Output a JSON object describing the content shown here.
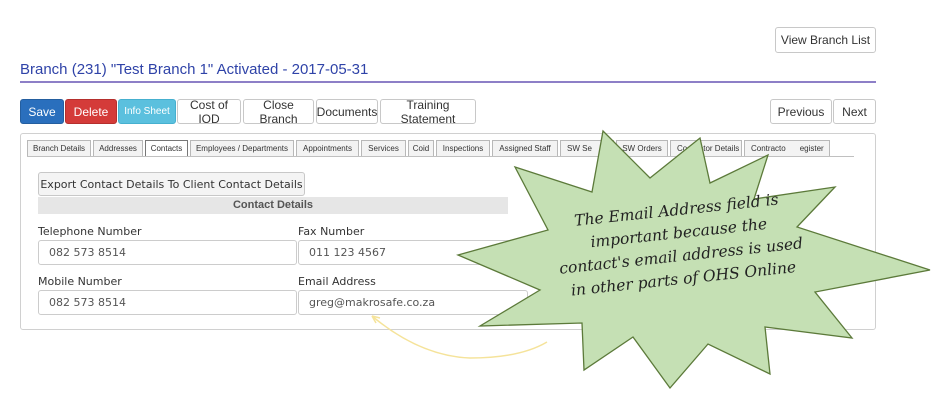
{
  "top_button": "View Branch List",
  "page_title": "Branch (231) \"Test Branch 1\" Activated - 2017-05-31",
  "toolbar": {
    "save": "Save",
    "delete": "Delete",
    "info_sheet": "Info Sheet",
    "cost_of_iod": "Cost of IOD",
    "close_branch": "Close Branch",
    "documents": "Documents",
    "training_statement": "Training Statement",
    "previous": "Previous",
    "next": "Next"
  },
  "tabs": [
    "Branch Details",
    "Addresses",
    "Contacts",
    "Employees / Departments",
    "Appointments",
    "Services",
    "Coid",
    "Inspections",
    "Assigned Staff",
    "SW Se",
    "SW Orders",
    "Co",
    "ctor Details",
    "Contracto",
    "egister"
  ],
  "export_button": "Export Contact Details To Client Contact Details",
  "section_title": "Contact Details",
  "fields": {
    "telephone_label": "Telephone Number",
    "telephone_value": "082 573 8514",
    "fax_label": "Fax Number",
    "fax_value": "011 123 4567",
    "mobile_label": "Mobile Number",
    "mobile_value": "082 573 8514",
    "email_label": "Email Address",
    "email_value": "greg@makrosafe.co.za"
  },
  "callout": {
    "line1": "The Email Address field is",
    "line2": "important because the",
    "line3": "contact's email address is used",
    "line4": "in other parts of OHS Online"
  },
  "colors": {
    "save": "#2a6fbd",
    "delete": "#d43b39",
    "info_sheet": "#5bc0de",
    "title": "#2f43a8",
    "callout_fill": "#c5e0b4",
    "callout_stroke": "#5c7a3a",
    "arrow": "#f5e39a"
  }
}
